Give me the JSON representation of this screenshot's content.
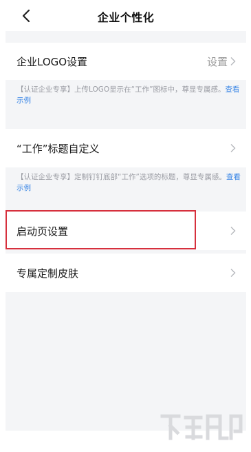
{
  "header": {
    "title": "企业个性化",
    "back_icon": "chevron-left-icon"
  },
  "rows": [
    {
      "id": "logo",
      "label": "企业LOGO设置",
      "value": "设置"
    },
    {
      "id": "work-title",
      "label": "“工作”标题自定义",
      "value": ""
    },
    {
      "id": "launch-page",
      "label": "启动页设置",
      "value": ""
    },
    {
      "id": "skin",
      "label": "专属定制皮肤",
      "value": ""
    }
  ],
  "notes": [
    {
      "text": "【认证企业专享】上传LOGO显示在“工作”图标中，尊显专属感。",
      "link": "查看示例"
    },
    {
      "text": "【认证企业专享】定制钉钉底部“工作”选项的标题，尊显专属感。",
      "link": "查看示例"
    }
  ],
  "colors": {
    "highlight": "#d6303d",
    "link": "#3a86e6",
    "background": "#f4f5f7"
  }
}
